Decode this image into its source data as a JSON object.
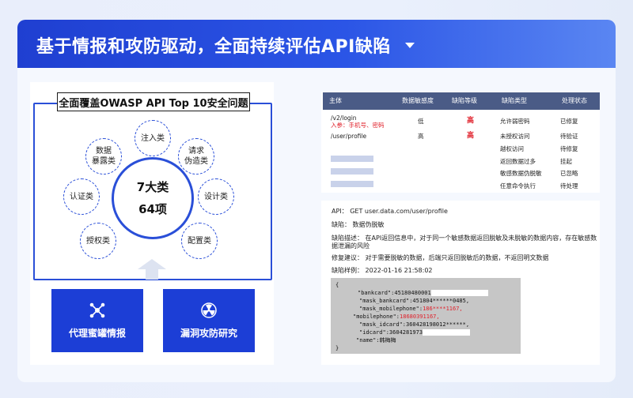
{
  "banner": {
    "title": "基于情报和攻防驱动，全面持续评估API缺陷"
  },
  "left": {
    "frame_title": "全面覆盖OWASP API Top 10安全问题",
    "center_line1": "7大类",
    "center_line2": "64项",
    "nodes": [
      {
        "label": "注入类"
      },
      {
        "label": "请求\n伪造类"
      },
      {
        "label": "设计类"
      },
      {
        "label": "配置类"
      },
      {
        "label": "授权类"
      },
      {
        "label": "认证类"
      },
      {
        "label": "数据\n暴露类"
      }
    ],
    "features": [
      {
        "label": "代理蜜罐情报",
        "icon": "network-nodes-icon"
      },
      {
        "label": "漏洞攻防研究",
        "icon": "radiation-icon"
      }
    ]
  },
  "table": {
    "headers": [
      "主体",
      "数据敏感度",
      "缺陷等级",
      "缺陷类型",
      "处理状态"
    ],
    "rows": [
      {
        "subject": "/v2/login",
        "subject_note": "入参：手机号、密码",
        "sensitivity": "低",
        "level": "高",
        "type": "允许弱密码",
        "status": "已修复"
      },
      {
        "subject": "/user/profile",
        "subject_note": "",
        "sensitivity": "高",
        "level": "高",
        "type": "未授权访问",
        "status": "待验证"
      },
      {
        "subject": "",
        "subject_note": "",
        "sensitivity": "",
        "level": "",
        "type": "越权访问",
        "status": "待修复"
      },
      {
        "subject": "",
        "subject_note": "",
        "sensitivity": "",
        "level": "",
        "type": "返回数据过多",
        "status": "挂起"
      },
      {
        "subject": "",
        "subject_note": "",
        "sensitivity": "",
        "level": "",
        "type": "敏感数据伪脱敏",
        "status": "已忽略"
      },
      {
        "subject": "",
        "subject_note": "",
        "sensitivity": "",
        "level": "",
        "type": "任意命令执行",
        "status": "待处理"
      }
    ]
  },
  "detail": {
    "api": "API：  GET user.data.com/user/profile",
    "defect": "缺陷：  数据伪脱敏",
    "desc_line1": "缺陷描述：   在API返回信息中，对于同一个敏感数据返回脱敏及未脱敏的数据内容，存在敏感数",
    "desc_line2": "据泄漏的风险",
    "fix": "修复建议：   对于需要脱敏的数据，后端只返回脱敏后的数据，不返回明文数据",
    "sample": "缺陷样例：   2022-01-16 21:58:02",
    "code": {
      "open": "{",
      "l1": "\"bankcard\":45180480001",
      "l2": "\"mask_bankcard\":451804******0485,",
      "l3a": "\"mask_mobilephone\":",
      "l3b": "186****1167,",
      "l4a": "\"mobilephone\":",
      "l4b": "18680391167,",
      "l5": "\"mask_idcard\":360428198012******,",
      "l6": "\"idcard\":3604281973",
      "l7": "\"name\":韩梅梅",
      "close": "}"
    }
  },
  "colors": {
    "primary": "#2a4fd8",
    "feature": "#1c3ed6",
    "header": "#4a5b86",
    "danger": "#e0202a"
  }
}
